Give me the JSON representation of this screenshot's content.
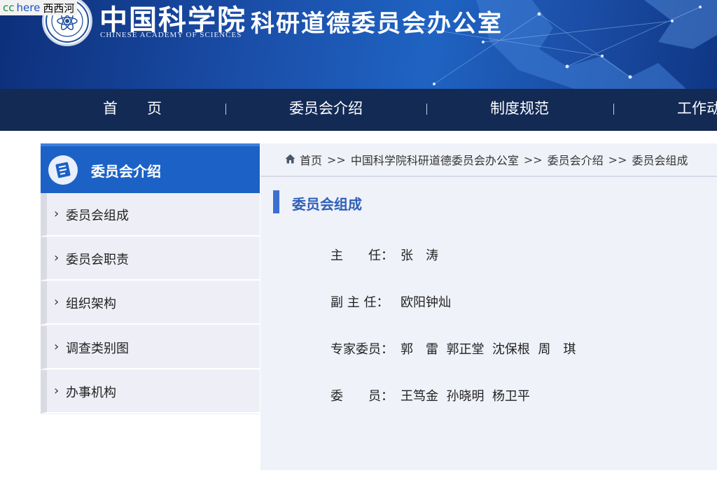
{
  "watermark": {
    "prefix": "cc",
    "link": "here",
    "site": "西西河"
  },
  "header": {
    "logo_cn": "中国科学院",
    "logo_en": "CHINESE  ACADEMY  OF  SCIENCES",
    "site_title": "科研道德委员会办公室"
  },
  "nav": {
    "items": [
      {
        "label": "首　　页"
      },
      {
        "label": "委员会介绍"
      },
      {
        "label": "制度规范"
      },
      {
        "label": "工作动"
      }
    ]
  },
  "sidebar": {
    "title": "委员会介绍",
    "items": [
      {
        "label": "委员会组成"
      },
      {
        "label": "委员会职责"
      },
      {
        "label": "组织架构"
      },
      {
        "label": "调查类别图"
      },
      {
        "label": "办事机构"
      }
    ]
  },
  "breadcrumb": {
    "items": [
      "首页",
      "中国科学院科研道德委员会办公室",
      "委员会介绍",
      "委员会组成"
    ],
    "separator": ">>"
  },
  "content": {
    "section_title": "委员会组成",
    "members": [
      {
        "role": "主　　任：",
        "names": "张　涛"
      },
      {
        "role": "副 主 任：",
        "names": "欧阳钟灿"
      },
      {
        "role": "专家委员：",
        "names": "郭　雷  郭正堂  沈保根  周　琪"
      },
      {
        "role": "委　　员：",
        "names": "王笃金  孙晓明  杨卫平"
      }
    ]
  },
  "colors": {
    "header_blue": "#1a4ea8",
    "nav_bg": "#132a55",
    "sidebar_head": "#1c62c6",
    "accent": "#3d6fd1"
  },
  "icons": [
    "emblem-logo",
    "list-icon",
    "home-icon",
    "chevron-right-icon"
  ]
}
